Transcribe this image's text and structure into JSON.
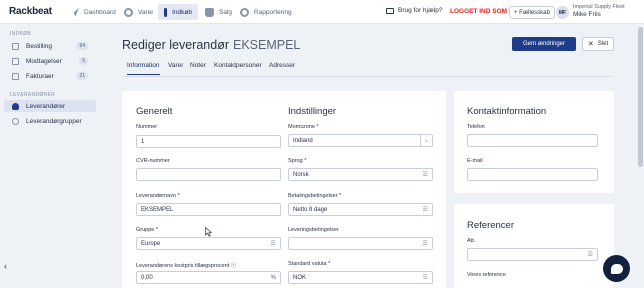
{
  "topbar": {
    "logo": "Rackbeat",
    "nav": [
      {
        "label": "Dashboard",
        "icon": "dashboard-icon"
      },
      {
        "label": "Varer",
        "icon": "gear-icon"
      },
      {
        "label": "Indkøb",
        "icon": "cart-icon"
      },
      {
        "label": "Salg",
        "icon": "bag-icon"
      },
      {
        "label": "Rapportering",
        "icon": "clock-icon"
      }
    ],
    "help": "Brug for hjælp?",
    "logged_in": "LOGGET IND SOM",
    "shared": "+ Fællesskab",
    "avatar_initials": "MF",
    "company": "Imperial Supply Fleet",
    "user": "Mike Friis"
  },
  "sidebar": {
    "section1": "INDKØB",
    "items1": [
      {
        "label": "Bestilling",
        "count": "64"
      },
      {
        "label": "Modtagelser",
        "count": "5"
      },
      {
        "label": "Fakturaer",
        "count": "21"
      }
    ],
    "section2": "LEVERANDØRER",
    "items2": [
      {
        "label": "Leverandører"
      },
      {
        "label": "Leverandørgrupper"
      }
    ],
    "collapse": "‹"
  },
  "header": {
    "title": "Rediger leverandør",
    "subtitle": "EKSEMPEL",
    "save_label": "Gem ændringer",
    "close_label": "Slet"
  },
  "tabs": [
    "Information",
    "Varer",
    "Noter",
    "Kontaktpersoner",
    "Adresser"
  ],
  "general": {
    "title": "Generelt",
    "number_label": "Nummer",
    "number_value": "1",
    "cvr_label": "CVR-nummer",
    "cvr_value": "",
    "name_label": "Leverandørnavn *",
    "name_value": "EKSEMPEL",
    "group_label": "Gruppe *",
    "group_value": "Europe",
    "cost_label": "Leverandørens kostpris tillægsprocent ⓘ",
    "cost_value": "0,00",
    "cost_suffix": "%"
  },
  "settings": {
    "title": "Indstillinger",
    "vat_label": "Momszone *",
    "vat_value": "Indland",
    "lang_label": "Sprog *",
    "lang_value": "Norsk",
    "payment_label": "Betalingsbetingelser *",
    "payment_value": "Netto 8 dage",
    "delivery_label": "Leveringsbetingelser",
    "delivery_value": "",
    "currency_label": "Standard valuta *",
    "currency_value": "NOK"
  },
  "contact": {
    "title": "Kontaktinformation",
    "phone_label": "Telefon",
    "phone_value": "",
    "email_label": "E-mail",
    "email_value": ""
  },
  "references": {
    "title": "Referencer",
    "att_label": "Att.",
    "att_value": "",
    "our_ref_label": "Vores reference"
  },
  "colors": {
    "primary": "#1f3c88",
    "danger": "#e02020",
    "background": "#eef1f6"
  }
}
